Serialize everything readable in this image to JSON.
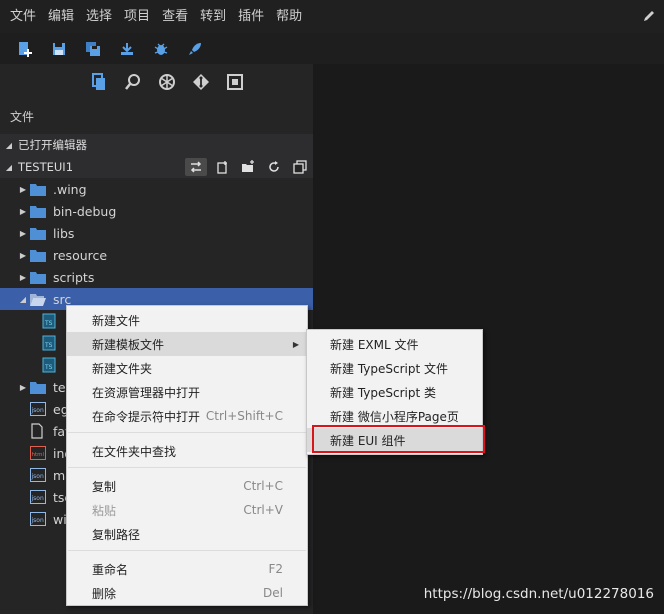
{
  "menubar": {
    "items": [
      "文件",
      "编辑",
      "选择",
      "项目",
      "查看",
      "转到",
      "插件",
      "帮助"
    ],
    "icon": "pen-icon"
  },
  "toolbar": {
    "icons": [
      "new-project-icon",
      "save-icon",
      "save-all-icon",
      "publish-icon",
      "debug-icon",
      "launch-icon"
    ]
  },
  "viewbar": {
    "icons": [
      "explorer-icon",
      "search-icon",
      "extensions-icon",
      "git-icon",
      "layout-icon"
    ],
    "active": "explorer-icon"
  },
  "panel": {
    "title": "文件"
  },
  "sections": {
    "open_editors": "已打开编辑器",
    "project": "TESTEUI1"
  },
  "tree": [
    {
      "name": ".wing",
      "type": "folder"
    },
    {
      "name": "bin-debug",
      "type": "folder"
    },
    {
      "name": "libs",
      "type": "folder"
    },
    {
      "name": "resource",
      "type": "folder"
    },
    {
      "name": "scripts",
      "type": "folder"
    },
    {
      "name": "src",
      "type": "folder-open",
      "selected": true
    },
    {
      "name": "",
      "type": "ts"
    },
    {
      "name": "",
      "type": "ts"
    },
    {
      "name": "",
      "type": "ts"
    },
    {
      "name": "te",
      "type": "folder"
    },
    {
      "name": "eg",
      "type": "json"
    },
    {
      "name": "fav",
      "type": "file"
    },
    {
      "name": "ind",
      "type": "html"
    },
    {
      "name": "ma",
      "type": "json"
    },
    {
      "name": "tsc",
      "type": "json"
    },
    {
      "name": "wi",
      "type": "json"
    }
  ],
  "context_menu": {
    "items": [
      {
        "label": "新建文件",
        "shortcut": ""
      },
      {
        "label": "新建模板文件",
        "shortcut": "",
        "submenu": true
      },
      {
        "label": "新建文件夹",
        "shortcut": ""
      },
      {
        "label": "在资源管理器中打开",
        "shortcut": ""
      },
      {
        "label": "在命令提示符中打开",
        "shortcut": "Ctrl+Shift+C"
      },
      {
        "label": "在文件夹中查找",
        "shortcut": ""
      },
      {
        "label": "复制",
        "shortcut": "Ctrl+C"
      },
      {
        "label": "粘贴",
        "shortcut": "Ctrl+V",
        "disabled": true
      },
      {
        "label": "复制路径",
        "shortcut": ""
      },
      {
        "label": "重命名",
        "shortcut": "F2"
      },
      {
        "label": "删除",
        "shortcut": "Del"
      }
    ]
  },
  "submenu": {
    "items": [
      "新建 EXML 文件",
      "新建 TypeScript 文件",
      "新建 TypeScript 类",
      "新建 微信小程序Page页",
      "新建 EUI 组件"
    ],
    "highlighted_index": 4
  },
  "watermark": "https://blog.csdn.net/u012278016",
  "colors": {
    "accent": "#3b5fa8",
    "folder": "#4f8fd6",
    "highlight_border": "#d9151c"
  }
}
